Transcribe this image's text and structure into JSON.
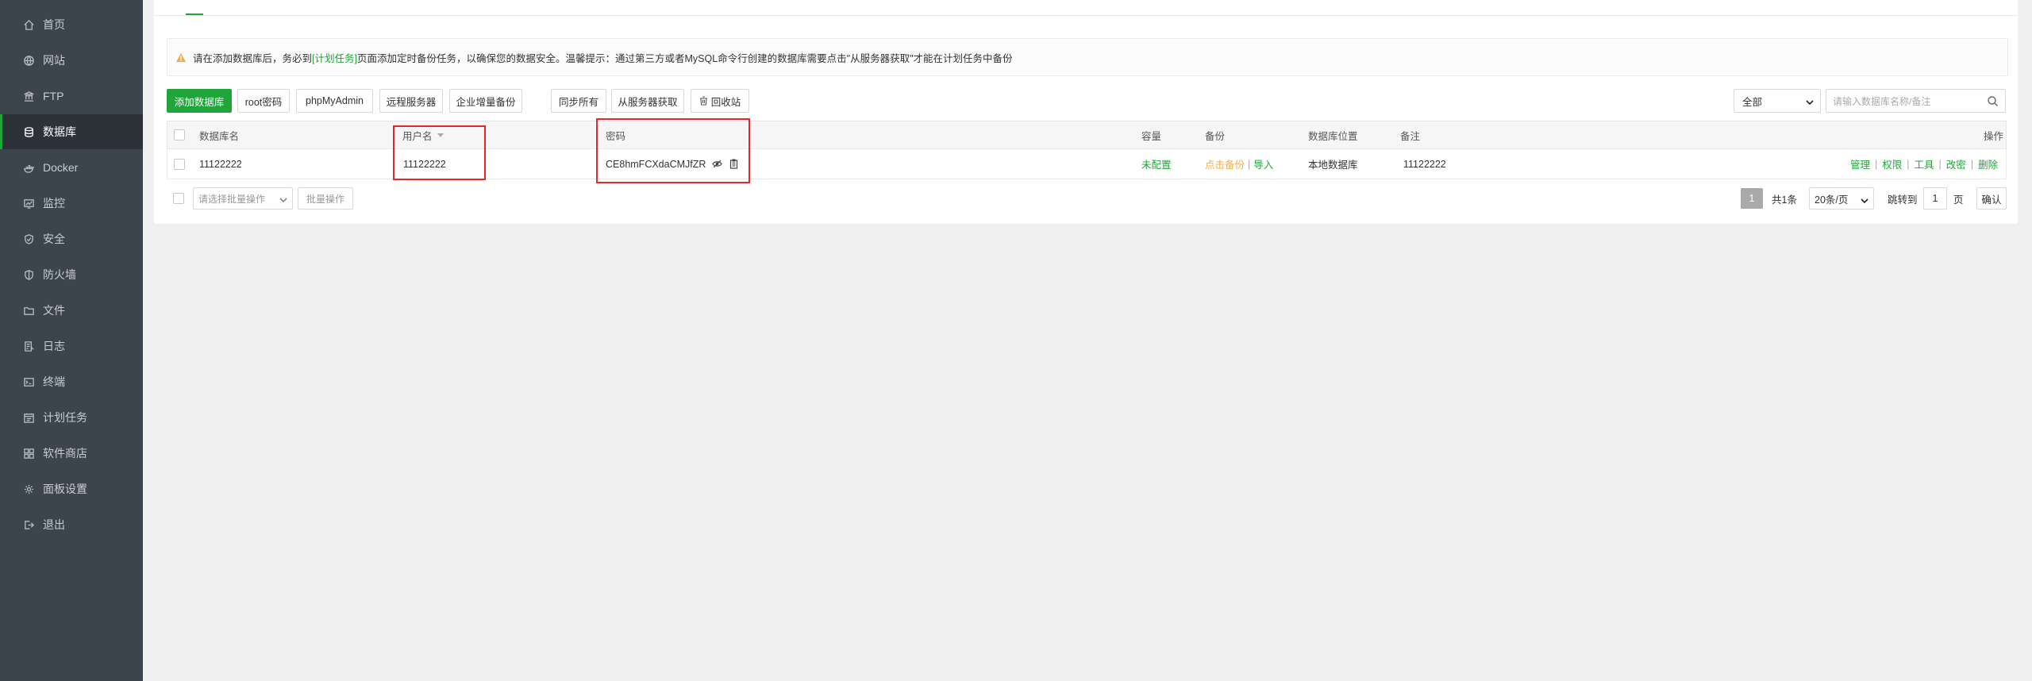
{
  "sidebar": {
    "items": [
      {
        "label": "首页",
        "icon": "home-icon"
      },
      {
        "label": "网站",
        "icon": "globe-icon"
      },
      {
        "label": "FTP",
        "icon": "ftp-icon"
      },
      {
        "label": "数据库",
        "icon": "database-icon",
        "active": true
      },
      {
        "label": "Docker",
        "icon": "docker-icon"
      },
      {
        "label": "监控",
        "icon": "monitor-icon"
      },
      {
        "label": "安全",
        "icon": "shield-icon"
      },
      {
        "label": "防火墙",
        "icon": "firewall-icon"
      },
      {
        "label": "文件",
        "icon": "folder-icon"
      },
      {
        "label": "日志",
        "icon": "log-icon"
      },
      {
        "label": "终端",
        "icon": "terminal-icon"
      },
      {
        "label": "计划任务",
        "icon": "calendar-icon"
      },
      {
        "label": "软件商店",
        "icon": "apps-icon"
      },
      {
        "label": "面板设置",
        "icon": "settings-icon"
      },
      {
        "label": "退出",
        "icon": "logout-icon"
      }
    ]
  },
  "notice": {
    "text_before": "请在添加数据库后，务必到",
    "link": "[计划任务]",
    "text_after": "页面添加定时备份任务，以确保您的数据安全。温馨提示：通过第三方或者MySQL命令行创建的数据库需要点击\"从服务器获取\"才能在计划任务中备份"
  },
  "toolbar": {
    "add_db": "添加数据库",
    "root_pwd": "root密码",
    "phpmyadmin": "phpMyAdmin",
    "remote_server": "远程服务器",
    "enterprise_backup": "企业增量备份",
    "sync_all": "同步所有",
    "get_from_server": "从服务器获取",
    "recycle_bin": "回收站"
  },
  "filter": {
    "selected": "全部",
    "search_placeholder": "请输入数据库名称/备注"
  },
  "table": {
    "headers": {
      "name": "数据库名",
      "username": "用户名",
      "password": "密码",
      "capacity": "容量",
      "backup": "备份",
      "location": "数据库位置",
      "remark": "备注",
      "actions": "操作"
    },
    "rows": [
      {
        "name": "11122222",
        "username": "11122222",
        "password": "CE8hmFCXdaCMJfZR",
        "capacity": "未配置",
        "backup_action": "点击备份",
        "import_action": "导入",
        "location": "本地数据库",
        "remark": "11122222",
        "actions": [
          "管理",
          "权限",
          "工具",
          "改密",
          "删除"
        ]
      }
    ]
  },
  "footer": {
    "batch_placeholder": "请选择批量操作",
    "batch_button": "批量操作",
    "current_page": "1",
    "total": "共1条",
    "page_size": "20条/页",
    "jump_to": "跳转到",
    "page_input": "1",
    "page_unit": "页",
    "confirm": "确认"
  },
  "colors": {
    "sidebar_bg": "#3c444d",
    "accent": "#20a53a",
    "warning": "#f0ad4e",
    "annotation": "#e02a2a"
  }
}
